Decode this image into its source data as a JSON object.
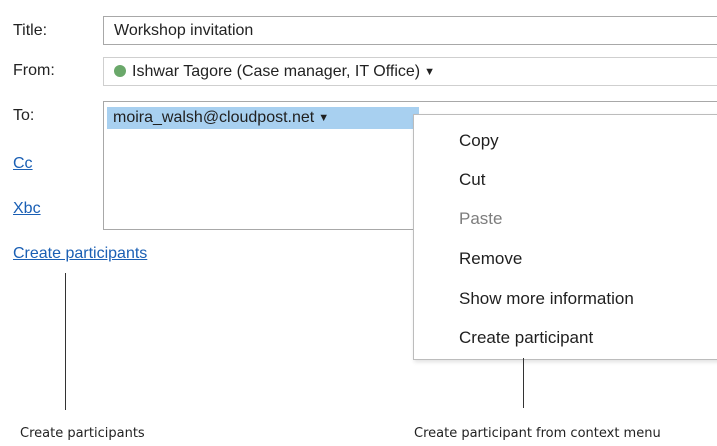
{
  "form": {
    "title_label": "Title:",
    "title_value": "Workshop invitation",
    "from_label": "From:",
    "from_value": "Ishwar Tagore (Case manager, IT Office)",
    "to_label": "To:",
    "to_recipient": "moira_walsh@cloudpost.net",
    "cc_link": "Cc",
    "xbc_link": "Xbc",
    "create_participants_link": "Create participants"
  },
  "context_menu": {
    "items": [
      {
        "label": "Copy",
        "enabled": true
      },
      {
        "label": "Cut",
        "enabled": true
      },
      {
        "label": "Paste",
        "enabled": false
      },
      {
        "label": "Remove",
        "enabled": true
      },
      {
        "label": "Show more information",
        "enabled": true
      },
      {
        "label": "Create participant",
        "enabled": true
      }
    ]
  },
  "annotations": {
    "left_caption": "Create participants",
    "right_caption": "Create participant from context menu"
  },
  "icons": {
    "from_status": "status-dot-icon",
    "dropdown": "caret-down-icon"
  },
  "colors": {
    "link": "#1a5fb4",
    "chip_highlight": "#a8d0f0",
    "status_dot": "#6aa86a"
  }
}
